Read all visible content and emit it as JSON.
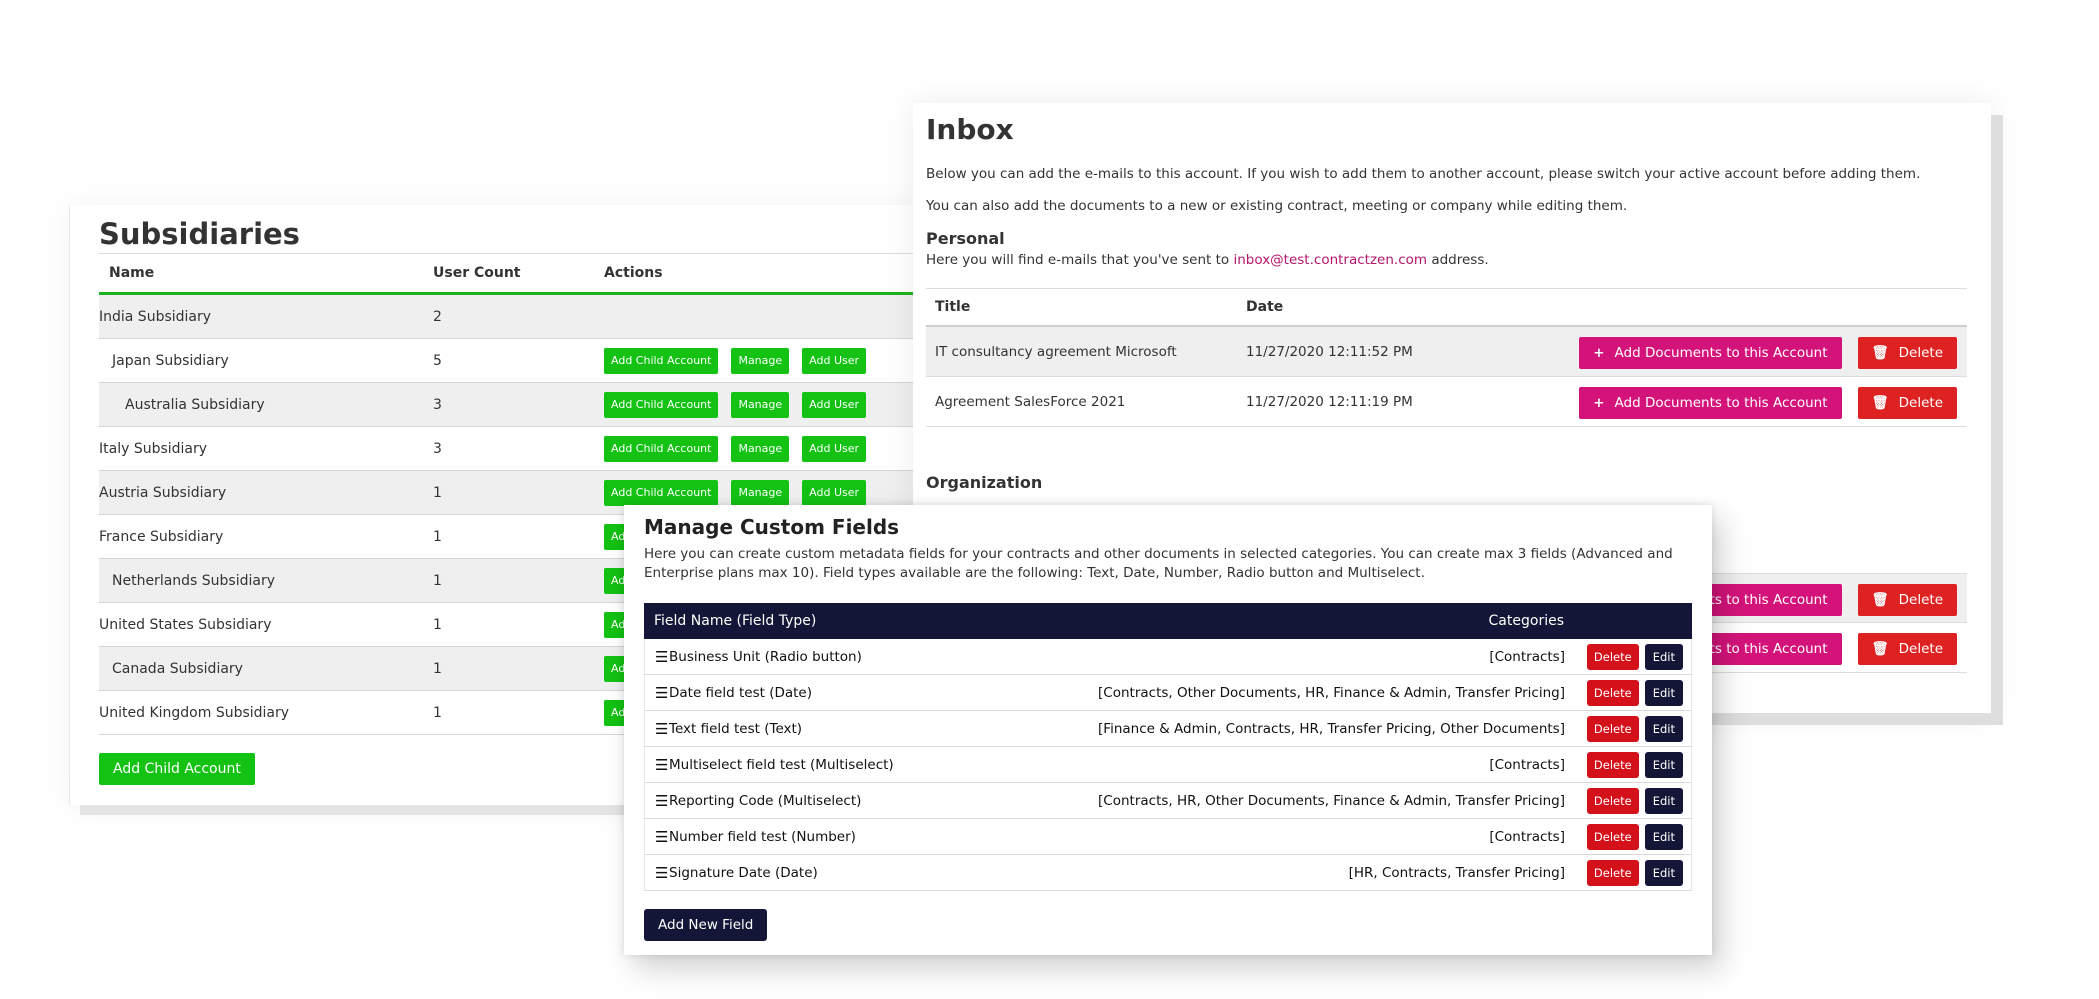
{
  "subsidiaries": {
    "title": "Subsidiaries",
    "columns": [
      "Name",
      "User Count",
      "Actions"
    ],
    "rows": [
      {
        "name": "India Subsidiary",
        "indent": 0,
        "count": "2",
        "actions": false
      },
      {
        "name": "Japan Subsidiary",
        "indent": 1,
        "count": "5",
        "actions": true
      },
      {
        "name": "Australia Subsidiary",
        "indent": 2,
        "count": "3",
        "actions": true
      },
      {
        "name": "Italy Subsidiary",
        "indent": 0,
        "count": "3",
        "actions": true
      },
      {
        "name": "Austria Subsidiary",
        "indent": 0,
        "count": "1",
        "actions": true
      },
      {
        "name": "France Subsidiary",
        "indent": 0,
        "count": "1",
        "actions": true
      },
      {
        "name": "Netherlands Subsidiary",
        "indent": 1,
        "count": "1",
        "actions": true
      },
      {
        "name": "United States Subsidiary",
        "indent": 0,
        "count": "1",
        "actions": true
      },
      {
        "name": "Canada Subsidiary",
        "indent": 1,
        "count": "1",
        "actions": true
      },
      {
        "name": "United Kingdom Subsidiary",
        "indent": 0,
        "count": "1",
        "actions": true
      }
    ],
    "row_actions": {
      "add_child": "Add Child Account",
      "manage": "Manage",
      "add_user": "Add User"
    },
    "add_child_button": "Add Child Account"
  },
  "inbox": {
    "title": "Inbox",
    "desc1": "Below you can add the e-mails to this account. If you wish to add them to another account, please switch your active account before adding them.",
    "desc2": "You can also add the documents to a new or existing contract, meeting or company while editing them.",
    "personal_heading": "Personal",
    "personal_text_before": "Here you will find e-mails that you've sent to ",
    "personal_email": "inbox@test.contractzen.com",
    "personal_text_after": " address.",
    "columns": [
      "Title",
      "Date"
    ],
    "rows": [
      {
        "title": "IT consultancy agreement Microsoft",
        "date": "11/27/2020 12:11:52 PM"
      },
      {
        "title": "Agreement SalesForce 2021",
        "date": "11/27/2020 12:11:19 PM"
      }
    ],
    "add_docs_label": "Add Documents to this Account",
    "delete_label": "Delete",
    "organization_heading": "Organization",
    "org_add_docs_partial": "ments to this Account"
  },
  "custom_fields": {
    "title": "Manage Custom Fields",
    "desc": "Here you can create custom metadata fields for your contracts and other documents in selected categories. You can create max 3 fields (Advanced and Enterprise plans max 10). Field types available are the following: Text, Date, Number, Radio button and Multiselect.",
    "columns": {
      "name": "Field Name (Field Type)",
      "categories": "Categories"
    },
    "rows": [
      {
        "name": "Business Unit (Radio button)",
        "categories": "[Contracts]"
      },
      {
        "name": "Date field test (Date)",
        "categories": "[Contracts, Other Documents, HR, Finance & Admin, Transfer Pricing]"
      },
      {
        "name": "Text field test (Text)",
        "categories": "[Finance & Admin, Contracts, HR, Transfer Pricing, Other Documents]"
      },
      {
        "name": "Multiselect field test (Multiselect)",
        "categories": "[Contracts]"
      },
      {
        "name": "Reporting Code (Multiselect)",
        "categories": "[Contracts, HR, Other Documents, Finance & Admin, Transfer Pricing]"
      },
      {
        "name": "Number field test (Number)",
        "categories": "[Contracts]"
      },
      {
        "name": "Signature Date (Date)",
        "categories": "[HR, Contracts, Transfer Pricing]"
      }
    ],
    "delete_label": "Delete",
    "edit_label": "Edit",
    "add_button": "Add New Field"
  },
  "icons": {
    "drag": "drag-handle-icon",
    "plus": "plus-icon",
    "trash": "trash-icon"
  },
  "colors": {
    "green": "#13c213",
    "magenta": "#d4137a",
    "red": "#de2222",
    "navy": "#141638"
  }
}
